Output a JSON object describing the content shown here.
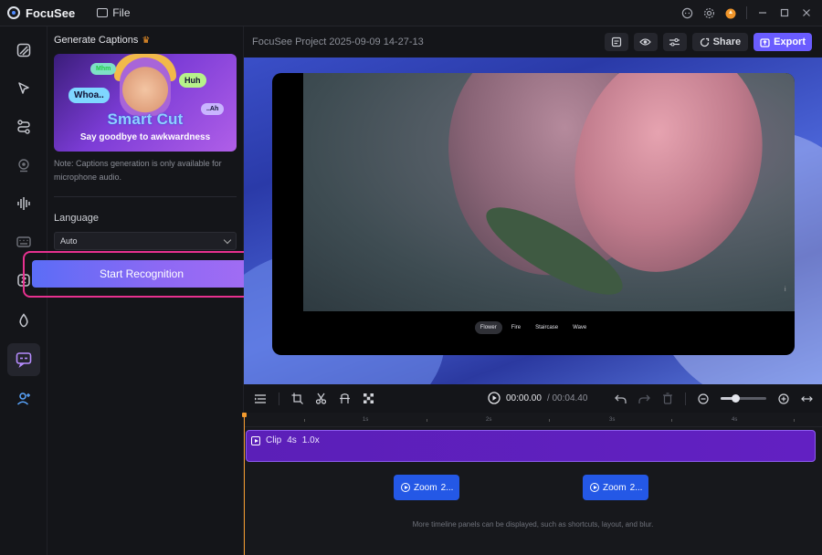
{
  "titlebar": {
    "app_name": "FocuSee",
    "file_menu": "File",
    "icons": [
      "chat-icon",
      "gear-icon",
      "upgrade-icon",
      "minimize-icon",
      "maximize-icon",
      "close-icon"
    ]
  },
  "rail": {
    "items": [
      "canvas-icon",
      "cursor-icon",
      "path-icon",
      "webcam-icon",
      "audio-wave-icon",
      "keyboard-icon",
      "stickers-icon",
      "effects-icon",
      "captions-icon",
      "avatar-icon"
    ],
    "active_index": 8
  },
  "panel": {
    "title": "Generate Captions",
    "banner": {
      "bubble_1": "Whoa..",
      "bubble_2": "Mhm",
      "bubble_3": "Huh",
      "bubble_4": "..Ah",
      "headline": "Smart Cut",
      "tagline": "Say goodbye to awkwardness"
    },
    "note": "Note: Captions generation is only available for microphone audio.",
    "language_label": "Language",
    "language_value": "Auto",
    "start_button": "Start Recognition"
  },
  "topbar": {
    "project_name": "FocuSee Project 2025-09-09 14-27-13",
    "share_label": "Share",
    "export_label": "Export"
  },
  "preview": {
    "scene_tabs": [
      "Flower",
      "Fire",
      "Staircase",
      "Wave"
    ],
    "active_scene": "Flower",
    "side_mark": "i"
  },
  "toolbar": {
    "current_time": "00:00.00",
    "total_time": "/ 00:04.40"
  },
  "timeline": {
    "ticks": [
      "1s",
      "2s",
      "3s",
      "4s"
    ],
    "clip": {
      "label": "Clip",
      "duration": "4s",
      "speed": "1.0x"
    },
    "zoom_blocks": [
      {
        "label": "Zoom",
        "value": "2..."
      },
      {
        "label": "Zoom",
        "value": "2..."
      }
    ],
    "more_note": "More timeline panels can be displayed, such as shortcuts, layout, and blur."
  },
  "colors": {
    "accent": "#6a5cff",
    "highlight_border": "#e7318f",
    "clip": "#5b1fb8",
    "zoom": "#2458e6",
    "playhead": "#f29a2e"
  }
}
